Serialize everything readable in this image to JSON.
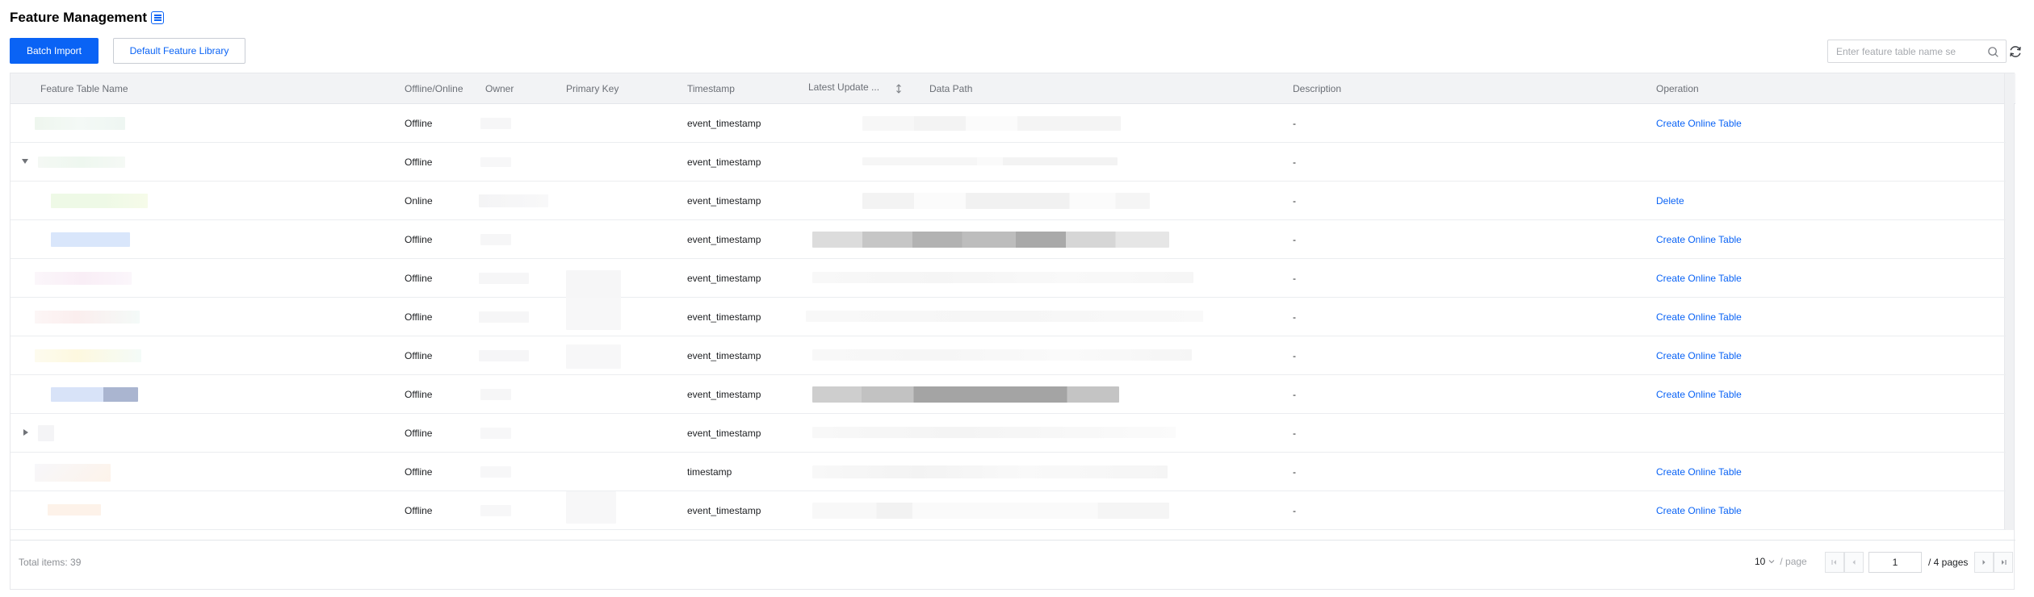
{
  "page": {
    "title": "Feature Management"
  },
  "toolbar": {
    "batch_import_label": "Batch Import",
    "default_library_label": "Default Feature Library",
    "search_placeholder": "Enter feature table name se"
  },
  "table": {
    "columns": {
      "name": "Feature Table Name",
      "mode": "Offline/Online",
      "owner": "Owner",
      "primary_key": "Primary Key",
      "timestamp": "Timestamp",
      "latest_update": "Latest Update ...",
      "data_path": "Data Path",
      "description": "Description",
      "operation": "Operation"
    },
    "rows": [
      {
        "mode": "Offline",
        "timestamp": "event_timestamp",
        "description": "-",
        "operation": "Create Online Table"
      },
      {
        "mode": "Offline",
        "timestamp": "event_timestamp",
        "description": "-",
        "operation": ""
      },
      {
        "mode": "Online",
        "timestamp": "event_timestamp",
        "description": "-",
        "operation": "Delete"
      },
      {
        "mode": "Offline",
        "timestamp": "event_timestamp",
        "description": "-",
        "operation": "Create Online Table"
      },
      {
        "mode": "Offline",
        "timestamp": "event_timestamp",
        "description": "-",
        "operation": "Create Online Table"
      },
      {
        "mode": "Offline",
        "timestamp": "event_timestamp",
        "description": "-",
        "operation": "Create Online Table"
      },
      {
        "mode": "Offline",
        "timestamp": "event_timestamp",
        "description": "-",
        "operation": "Create Online Table"
      },
      {
        "mode": "Offline",
        "timestamp": "event_timestamp",
        "description": "-",
        "operation": "Create Online Table"
      },
      {
        "mode": "Offline",
        "timestamp": "event_timestamp",
        "description": "-",
        "operation": ""
      },
      {
        "mode": "Offline",
        "timestamp": "timestamp",
        "description": "-",
        "operation": "Create Online Table"
      },
      {
        "mode": "Offline",
        "timestamp": "event_timestamp",
        "description": "-",
        "operation": "Create Online Table"
      }
    ]
  },
  "pagination": {
    "total_label": "Total items: 39",
    "page_size": "10",
    "page_size_unit": "/ page",
    "current_page": "1",
    "total_pages_label": "/ 4 pages"
  },
  "colors": {
    "accent": "#0a63f5"
  }
}
